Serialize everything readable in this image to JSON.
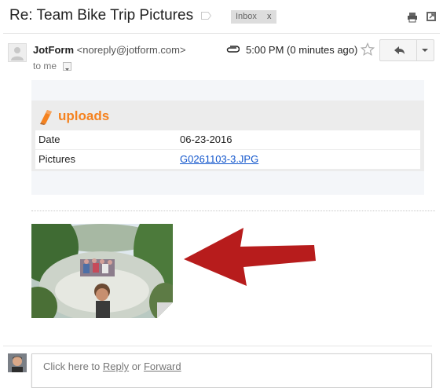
{
  "header": {
    "subject": "Re: Team Bike Trip Pictures",
    "label_chip": "Inbox",
    "label_remove": "x"
  },
  "message": {
    "sender_name": "JotForm",
    "sender_email": "<noreply@jotform.com>",
    "recipient": "to me",
    "time": "5:00 PM (0 minutes ago)"
  },
  "form": {
    "title": "uploads",
    "rows": [
      {
        "key": "Date",
        "value": "06-23-2016"
      },
      {
        "key": "Pictures",
        "value": "G0261103-3.JPG"
      }
    ],
    "accent_color": "#f5821f",
    "link_color": "#1155cc"
  },
  "annotation": {
    "arrow_color": "#b71c1c"
  },
  "reply_box": {
    "prefix": "Click here to",
    "reply": "Reply",
    "or": "or",
    "forward": "Forward"
  },
  "icons": [
    "label-icon",
    "print-icon",
    "new-window-icon",
    "avatar-icon",
    "paperclip-icon",
    "star-icon",
    "reply-icon",
    "chevron-down-icon",
    "jotform-logo-icon"
  ]
}
